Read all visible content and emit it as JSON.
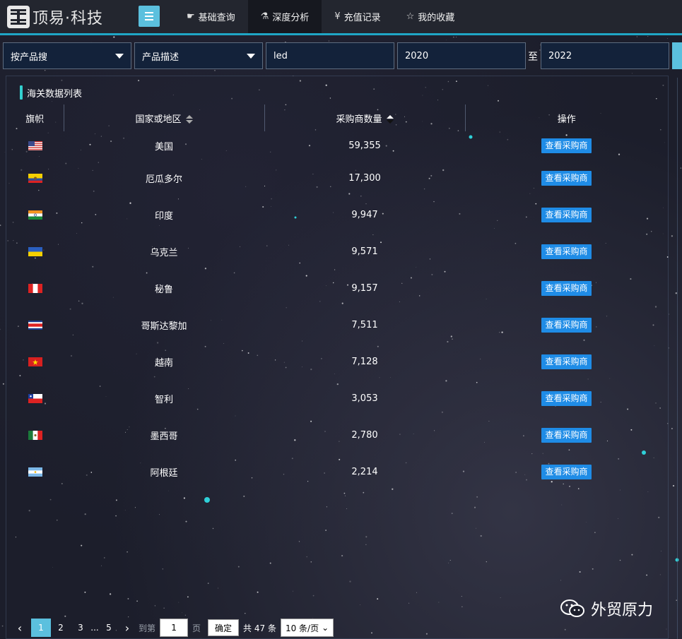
{
  "app": {
    "logo_text": "顶易·科技"
  },
  "nav": [
    {
      "label": "基础查询",
      "icon": "hand-icon",
      "active": false
    },
    {
      "label": "深度分析",
      "icon": "microscope-icon",
      "active": true
    },
    {
      "label": "充值记录",
      "icon": "yen-icon",
      "active": false
    },
    {
      "label": "我的收藏",
      "icon": "star-icon",
      "active": false
    }
  ],
  "search": {
    "mode": "按产品搜",
    "field": "产品描述",
    "keyword": "led",
    "year_from": "2020",
    "to_label": "至",
    "year_to": "2022"
  },
  "panel": {
    "title": "海关数据列表",
    "columns": {
      "flag": "旗帜",
      "country": "国家或地区",
      "count": "采购商数量",
      "action": "操作"
    },
    "rows": [
      {
        "country": "美国",
        "count": "59,355",
        "flag": "us",
        "action": "查看采购商"
      },
      {
        "country": "厄瓜多尔",
        "count": "17,300",
        "flag": "ec",
        "action": "查看采购商"
      },
      {
        "country": "印度",
        "count": "9,947",
        "flag": "in",
        "action": "查看采购商"
      },
      {
        "country": "乌克兰",
        "count": "9,571",
        "flag": "ua",
        "action": "查看采购商"
      },
      {
        "country": "秘鲁",
        "count": "9,157",
        "flag": "pe",
        "action": "查看采购商"
      },
      {
        "country": "哥斯达黎加",
        "count": "7,511",
        "flag": "cr",
        "action": "查看采购商"
      },
      {
        "country": "越南",
        "count": "7,128",
        "flag": "vn",
        "action": "查看采购商"
      },
      {
        "country": "智利",
        "count": "3,053",
        "flag": "cl",
        "action": "查看采购商"
      },
      {
        "country": "墨西哥",
        "count": "2,780",
        "flag": "mx",
        "action": "查看采购商"
      },
      {
        "country": "阿根廷",
        "count": "2,214",
        "flag": "ar",
        "action": "查看采购商"
      }
    ]
  },
  "pager": {
    "pages": [
      "1",
      "2",
      "3",
      "5"
    ],
    "current": "1",
    "dots": "...",
    "goto_label": "到第",
    "goto_value": "1",
    "page_unit": "页",
    "confirm": "确定",
    "total": "共 47 条",
    "page_size": "10 条/页"
  },
  "watermark": {
    "text": "外贸原力"
  },
  "colors": {
    "accent": "#5bc0de",
    "button": "#1f8ce6",
    "header": "#23262f",
    "input_bg": "#13223a"
  }
}
